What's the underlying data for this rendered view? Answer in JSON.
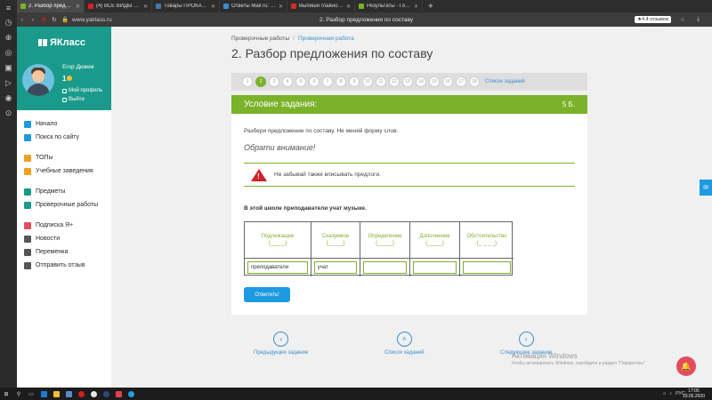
{
  "browser": {
    "tabs": [
      {
        "label": "2. Разбор предложе...",
        "color": "#7ab22a",
        "active": true
      },
      {
        "label": "(4) ВСЕ ВИДЫ ЭНЕРГЕТИ...",
        "color": "#e02020",
        "active": false
      },
      {
        "label": "Товары ПРОКАЧКА / БУС...",
        "color": "#4a76a8",
        "active": false
      },
      {
        "label": "Ответы Mail.ru: крупные ...",
        "color": "#3a8fd0",
        "active": false
      },
      {
        "label": "Выпиши главное слово и...",
        "color": "#d03020",
        "active": false
      },
      {
        "label": "Результаты - Годовая кон...",
        "color": "#7ab22a",
        "active": false
      }
    ],
    "url": "www.yaklass.ru",
    "page_title": "2. Разбор предложения по составу",
    "reviews_badge": "★4.4 отзывов"
  },
  "sidebar": {
    "brand": "ЯКласс",
    "user_name": "Егор Дюжик",
    "level": "1",
    "profile_link": "Мой профиль",
    "logout_link": "Выйти",
    "items": [
      {
        "label": "Начало",
        "color": "#1e9ae0"
      },
      {
        "label": "Поиск по сайту",
        "color": "#1e9ae0"
      },
      {
        "label": "ТОПы",
        "color": "#f0a020"
      },
      {
        "label": "Учебные заведения",
        "color": "#f0a020"
      },
      {
        "label": "Предметы",
        "color": "#1a9a8a"
      },
      {
        "label": "Проверочные работы",
        "color": "#1a9a8a"
      },
      {
        "label": "Подписка Я+",
        "color": "#e24c5c"
      },
      {
        "label": "Новости",
        "color": "#555555"
      },
      {
        "label": "Переменка",
        "color": "#555555"
      },
      {
        "label": "Отправить отзыв",
        "color": "#555555"
      }
    ]
  },
  "breadcrumb": {
    "parent": "Проверочные работы",
    "current": "Проверочная работа"
  },
  "title": "2. Разбор предложения по составу",
  "pager": {
    "pages": [
      "1",
      "2",
      "3",
      "4",
      "5",
      "6",
      "7",
      "8",
      "9",
      "10",
      "11",
      "12",
      "13",
      "14",
      "15",
      "16",
      "17",
      "18"
    ],
    "active_index": 1,
    "list_link": "Список заданий"
  },
  "task": {
    "header": "Условие задания:",
    "points": "5 Б.",
    "instruction": "Разбери предложение по составу. Не меняй форму слов.",
    "notice": "Обрати внимание!",
    "alert": "Не забывай также вписывать предлоги.",
    "sentence": "В этой школе преподаватели учат музыке.",
    "columns": [
      {
        "name": "Подлежащее",
        "blank": "(_____)"
      },
      {
        "name": "Сказуемое",
        "blank": "(_____)"
      },
      {
        "name": "Определение",
        "blank": "(_____)"
      },
      {
        "name": "Дополнение",
        "blank": "(_____)"
      },
      {
        "name": "Обстоятельство",
        "blank": "(_ _ _ _)"
      }
    ],
    "answers": [
      "преподаватели",
      "учат",
      "",
      "",
      ""
    ],
    "submit": "Ответить!"
  },
  "bottom_nav": {
    "prev": "Предыдущее задание",
    "list": "Список заданий",
    "next": "Следующее задание"
  },
  "watermark": {
    "title": "Активация Windows",
    "subtitle": "Чтобы активировать Windows, перейдите в раздел \"Параметры\""
  },
  "taskbar": {
    "lang": "РУС",
    "time": "17:05",
    "date": "19.05.2020"
  }
}
